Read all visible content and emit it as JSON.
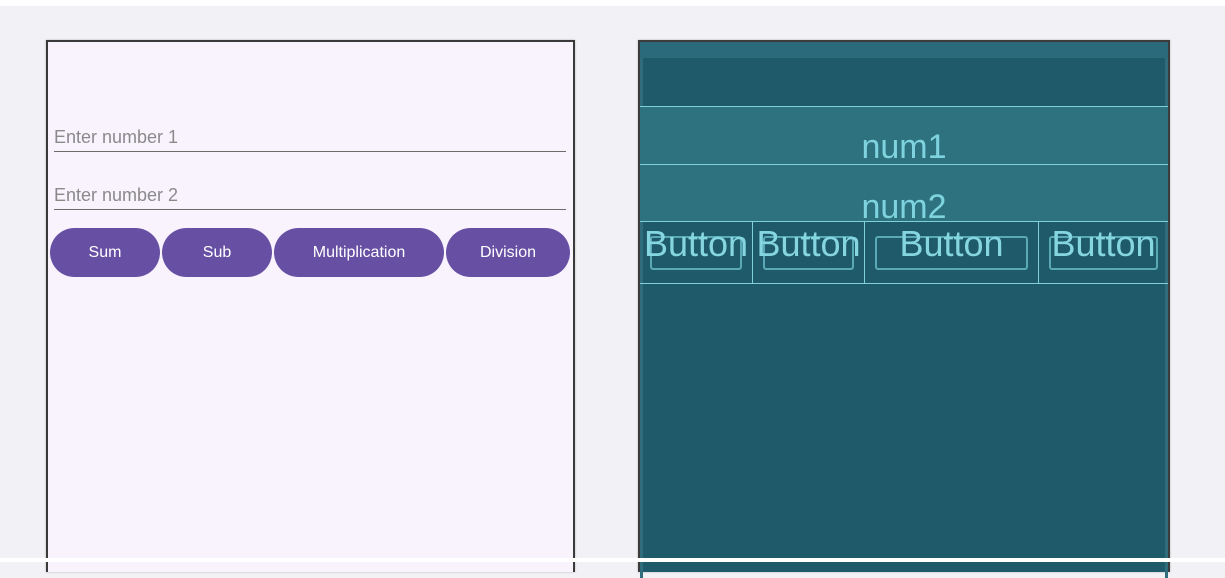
{
  "design": {
    "input1": {
      "placeholder": "Enter number 1"
    },
    "input2": {
      "placeholder": "Enter number 2"
    },
    "buttons": [
      "Sum",
      "Sub",
      "Multiplication",
      "Division"
    ]
  },
  "blueprint": {
    "field1": "num1",
    "field2": "num2",
    "buttons": [
      "Button",
      "Button",
      "Button",
      "Button"
    ]
  },
  "colors": {
    "accent": "#6750a4",
    "design_bg": "#f9f3fe",
    "blueprint_bg": "#1f5a6b",
    "blueprint_line": "#7fd0dc"
  }
}
